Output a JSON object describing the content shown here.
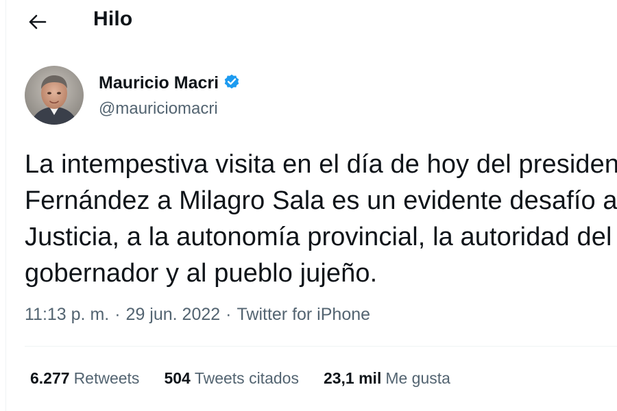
{
  "header": {
    "title": "Hilo",
    "back_icon": "arrow-left-icon"
  },
  "author": {
    "name": "Mauricio Macri",
    "handle": "@mauriciomacri",
    "verified": true,
    "verified_color": "#1d9bf0"
  },
  "tweet": {
    "lines": [
      "La intempestiva visita en el día de hoy del presidente",
      "Fernández a Milagro Sala es un evidente desafío a la",
      "Justicia, a la autonomía provincial, la autoridad del",
      "gobernador y al pueblo jujeño."
    ]
  },
  "meta": {
    "time": "11:13 p. m.",
    "separator": "·",
    "date": "29 jun. 2022",
    "source": "Twitter for iPhone"
  },
  "stats": {
    "retweets": {
      "count": "6.277",
      "label": "Retweets"
    },
    "quotes": {
      "count": "504",
      "label": "Tweets citados"
    },
    "likes": {
      "count": "23,1 mil",
      "label": "Me gusta"
    }
  },
  "colors": {
    "text_primary": "#0f1419",
    "text_secondary": "#536471",
    "divider": "#eff3f4"
  }
}
